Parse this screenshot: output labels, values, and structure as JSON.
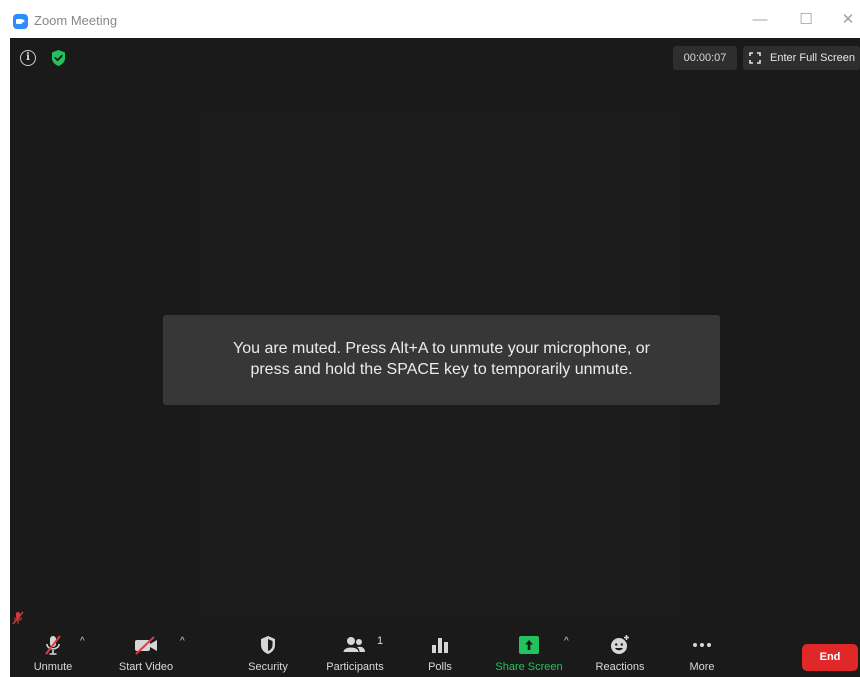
{
  "window": {
    "title": "Zoom Meeting",
    "controls": {
      "minimize": "—",
      "maximize": "☐",
      "close": "✕"
    }
  },
  "top_bar": {
    "info_glyph": "i",
    "timer": "00:00:07",
    "fullscreen_label": "Enter Full Screen"
  },
  "toast": {
    "line1": "You are muted. Press Alt+A to unmute your microphone, or",
    "line2": "press and hold the SPACE key to temporarily unmute."
  },
  "toolbar": {
    "unmute_label": "Unmute",
    "start_video_label": "Start Video",
    "security_label": "Security",
    "participants_label": "Participants",
    "participants_count": "1",
    "polls_label": "Polls",
    "share_screen_label": "Share Screen",
    "reactions_label": "Reactions",
    "more_label": "More",
    "end_label": "End",
    "caret": "^"
  },
  "colors": {
    "meeting_bg": "#1a1a1a",
    "accent_blue": "#2d8cff",
    "share_green": "#22c35f",
    "end_red": "#e02828",
    "muted_red": "#d23a3a"
  },
  "icons": [
    "zoom-logo-icon",
    "info-icon",
    "shield-check-icon",
    "fullscreen-icon",
    "microphone-muted-icon",
    "video-off-icon",
    "security-shield-icon",
    "participants-icon",
    "polls-icon",
    "share-screen-icon",
    "reactions-icon",
    "more-icon",
    "self-muted-indicator-icon"
  ]
}
